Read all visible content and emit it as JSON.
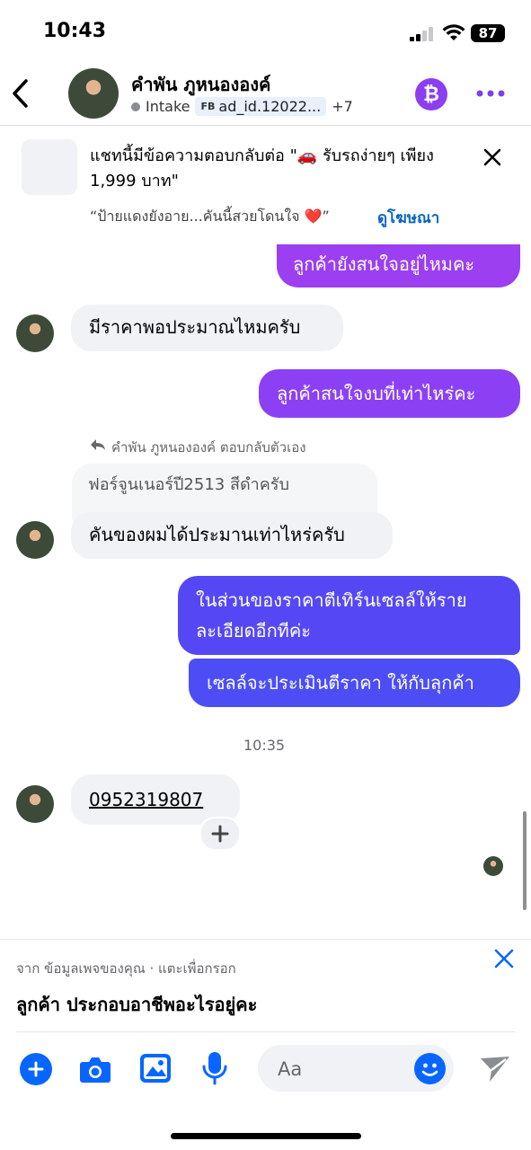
{
  "status": {
    "time": "10:43",
    "battery": "87"
  },
  "header": {
    "name": "คำพัน ภูหนององค์",
    "status_label": "Intake",
    "ad_tag": "FB",
    "ad_id": "ad_id.12022...",
    "extra_count": "+7"
  },
  "ad_card": {
    "text": "แชทนี้มีข้อความตอบกลับต่อ \"🚗 รับรถง่ายๆ เพียง 1,999 บาท\"",
    "quote": "“ป้ายแดงยังอาย...คันนี้สวยโดนใจ ❤️”",
    "link": "ดูโฆษณา"
  },
  "messages": {
    "m1": "ลูกค้ายังสนใจอยู่ไหมคะ",
    "m2": "มีราคาพอประมาณไหมครับ",
    "m3": "ลูกค้าสนใจงบที่เท่าไหร่คะ",
    "reply_note": "คำพัน ภูหนององค์ ตอบกลับตัวเอง",
    "m4_quoted": "ฟอร์จูนเนอร์ปี2513  สีดำครับ",
    "m4": "คันของผมได้ประมานเท่าไหร่ครับ",
    "m5_line1": "ในส่วนของราคาตีเทิร์นเซลล์ให้ราย",
    "m5_line2": "ละเอียดอีกทีค่ะ",
    "m6": "เซลล์จะประเมินตีราคา ให้กับลุกค้า",
    "time_label": "10:35",
    "m7": "0952319807"
  },
  "bottom": {
    "hint": "จาก ข้อมูลเพจของคุณ · แตะเพื่อกรอก",
    "question": "ลูกค้า ประกอบอาชีพอะไรอยู่คะ",
    "placeholder": "Aa"
  },
  "colors": {
    "accent": "#0866ff",
    "bubble_out_top": "#9b3ff0",
    "bubble_out_bottom": "#4c4df5",
    "bitcoin": "#8b3ff0"
  }
}
